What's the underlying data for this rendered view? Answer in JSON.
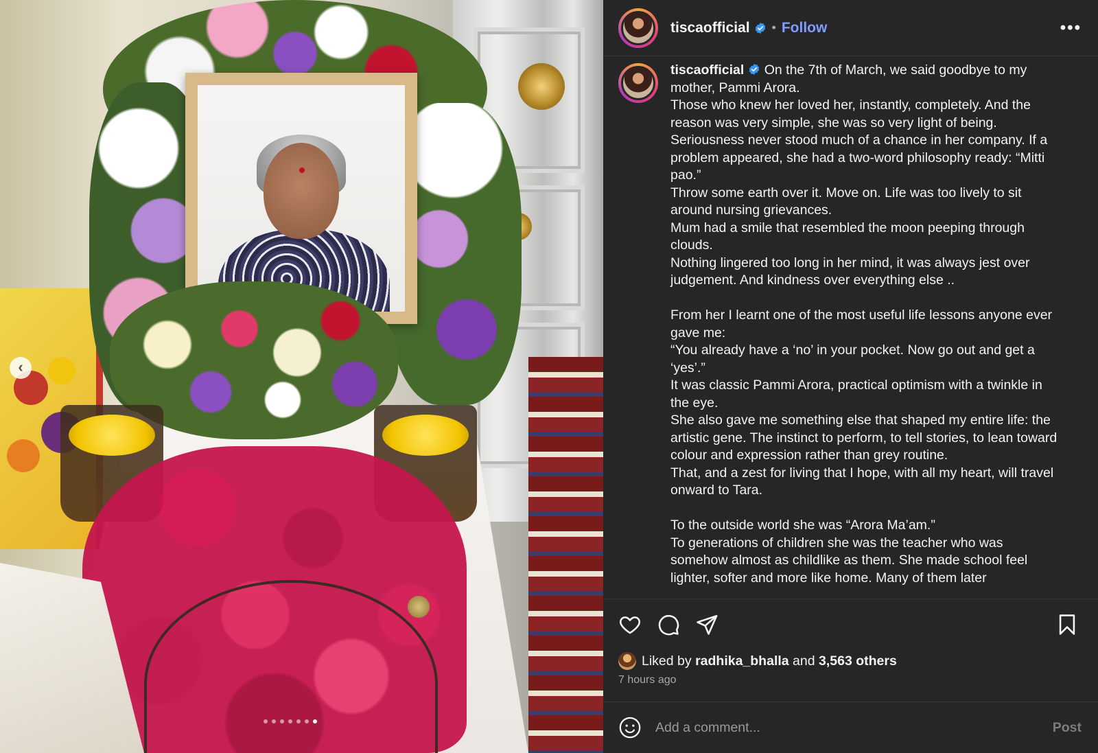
{
  "post": {
    "username": "tiscaofficial",
    "follow_label": "Follow",
    "separator": "•",
    "more_label": "•••"
  },
  "caption": {
    "username": "tiscaofficial",
    "lines": [
      "On the 7th of March, we said goodbye to my mother, Pammi Arora.",
      "Those who knew her loved her, instantly, completely. And the reason was very simple, she was so very light of being.",
      "Seriousness never stood much of a chance in her company. If a problem appeared, she had a two-word philosophy ready: “Mitti pao.”",
      "Throw some earth over it. Move on. Life was too lively to sit around nursing grievances.",
      "Mum had a smile that resembled the moon peeping through clouds.",
      "Nothing lingered too long in her mind, it was always jest over judgement. And kindness over everything else ..",
      "",
      "From her I learnt one of the most useful life lessons anyone ever gave me:",
      "“You already have a ‘no’ in your pocket. Now go out and get a ‘yes’.”",
      "It was classic Pammi Arora, practical optimism with a twinkle in the eye.",
      "She also gave me something else that shaped my entire life: the artistic gene. The instinct to perform, to tell stories, to lean toward colour and expression rather than grey routine.",
      "That, and a zest for living that I hope, with all my heart, will travel onward to Tara.",
      "",
      "To the outside world she was “Arora Ma’am.”",
      "To generations of children she was the teacher who was somehow almost as childlike as them. She made school feel lighter, softer and more like home. Many of them later"
    ]
  },
  "likes": {
    "prefix": "Liked by",
    "user": "radhika_bhalla",
    "joiner": "and",
    "others": "3,563 others"
  },
  "timeago": "7 hours ago",
  "comment": {
    "placeholder": "Add a comment...",
    "post_label": "Post"
  },
  "carousel": {
    "total_slides": 7,
    "active_index": 6,
    "prev_glyph": "‹"
  },
  "colors": {
    "panel_bg": "#262626",
    "link_blue": "#7f9cff",
    "verified_blue": "#3897f0"
  },
  "icons": [
    "heart-icon",
    "comment-icon",
    "share-icon",
    "bookmark-icon",
    "emoji-icon",
    "verified-badge-icon",
    "more-options-icon",
    "chevron-left-icon"
  ]
}
